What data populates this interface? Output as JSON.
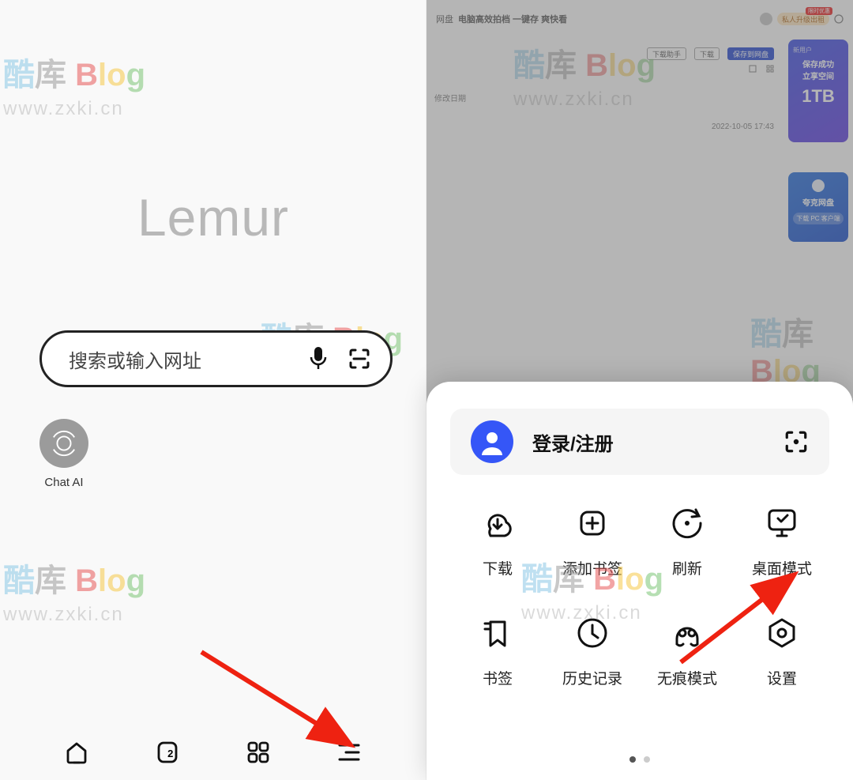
{
  "watermark": {
    "brand_cn": "酷库",
    "brand_en": "Blog",
    "url": "www.zxki.cn"
  },
  "left": {
    "brand": "Lemur",
    "search_placeholder": "搜索或输入网址",
    "shortcut": {
      "label": "Chat AI"
    },
    "nav": {
      "tab_count": "2"
    }
  },
  "right": {
    "header": {
      "title_fragment": "网盘",
      "subtitle": "电脑高效拍档 一键存 爽快看",
      "btn_download_helper": "下载助手",
      "btn_download": "下载",
      "btn_save_cloud": "保存到网盘",
      "promo": "私人升级出租",
      "promo_badge": "限时优惠"
    },
    "side_cards": {
      "c1_line1": "新用户",
      "c1_line2": "保存成功",
      "c1_line3": "立享空间",
      "c1_big": "1TB",
      "c2_line1": "夸克网盘",
      "c2_line2": "下载 PC 客户端"
    },
    "list": {
      "col_date": "修改日期",
      "row_date": "2022-10-05 17:43"
    },
    "sheet": {
      "profile_label": "登录/注册",
      "items": [
        {
          "key": "download",
          "label": "下载"
        },
        {
          "key": "add-bookmark",
          "label": "添加书签"
        },
        {
          "key": "refresh",
          "label": "刷新"
        },
        {
          "key": "desktop-mode",
          "label": "桌面模式"
        },
        {
          "key": "bookmarks",
          "label": "书签"
        },
        {
          "key": "history",
          "label": "历史记录"
        },
        {
          "key": "incognito",
          "label": "无痕模式"
        },
        {
          "key": "settings",
          "label": "设置"
        }
      ]
    }
  }
}
